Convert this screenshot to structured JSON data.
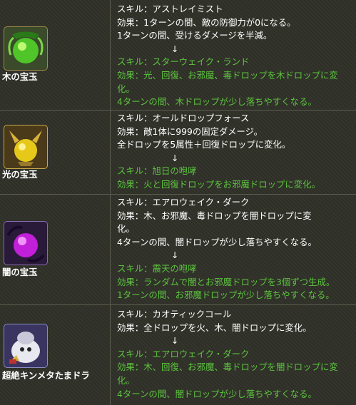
{
  "rows": [
    {
      "name": "木の宝玉",
      "icon": "green-orb-icon",
      "lines": [
        {
          "text": "スキル：アストレイミスト",
          "color": "white"
        },
        {
          "text": "効果：1ターンの間、敵の防御力が0になる。",
          "color": "white"
        },
        {
          "text": "1ターンの間、受けるダメージを半減。",
          "color": "white"
        },
        {
          "text": "↓",
          "color": "white",
          "arrow": true
        },
        {
          "text": "スキル：スターウェイク・ランド",
          "color": "green"
        },
        {
          "text": "効果：光、回復、お邪魔、毒ドロップを木ドロップに変",
          "color": "green"
        },
        {
          "text": "化。",
          "color": "green"
        },
        {
          "text": "4ターンの間、木ドロップが少し落ちやすくなる。",
          "color": "green"
        }
      ]
    },
    {
      "name": "光の宝玉",
      "icon": "yellow-orb-icon",
      "lines": [
        {
          "text": "スキル：オールドロップフォース",
          "color": "white"
        },
        {
          "text": "効果：敵1体に999の固定ダメージ。",
          "color": "white"
        },
        {
          "text": "全ドロップを5属性＋回復ドロップに変化。",
          "color": "white"
        },
        {
          "text": "↓",
          "color": "white",
          "arrow": true
        },
        {
          "text": "スキル：旭日の咆哮",
          "color": "green"
        },
        {
          "text": "効果：火と回復ドロップをお邪魔ドロップに変化。",
          "color": "green"
        }
      ]
    },
    {
      "name": "闇の宝玉",
      "icon": "purple-orb-icon",
      "lines": [
        {
          "text": "スキル：エアロウェイク・ダーク",
          "color": "white"
        },
        {
          "text": "効果：木、お邪魔、毒ドロップを闇ドロップに変",
          "color": "white"
        },
        {
          "text": "化。",
          "color": "white"
        },
        {
          "text": "4ターンの間、闇ドロップが少し落ちやすくなる。",
          "color": "white"
        },
        {
          "text": "↓",
          "color": "white",
          "arrow": true
        },
        {
          "text": "スキル：震天の咆哮",
          "color": "green"
        },
        {
          "text": "効果：ランダムで闇とお邪魔ドロップを3個ずつ生成。",
          "color": "green"
        },
        {
          "text": "1ターンの間、お邪魔ドロップが少し落ちやすくなる。",
          "color": "green"
        }
      ]
    },
    {
      "name": "超絶キンメタたまドラ",
      "icon": "king-metal-dragon-icon",
      "lines": [
        {
          "text": "スキル：カオティックコール",
          "color": "white"
        },
        {
          "text": "効果：全ドロップを火、木、闇ドロップに変化。",
          "color": "white"
        },
        {
          "text": "↓",
          "color": "white",
          "arrow": true
        },
        {
          "text": "スキル：エアロウェイク・ダーク",
          "color": "green"
        },
        {
          "text": "効果：木、回復、お邪魔、毒ドロップを闇ドロップに変",
          "color": "green"
        },
        {
          "text": "化。",
          "color": "green"
        },
        {
          "text": "4ターンの間、闇ドロップが少し落ちやすくなる。",
          "color": "green"
        }
      ]
    }
  ],
  "colors": {
    "white": "#ffffff",
    "green": "#5cc33e",
    "border": "#5c5c4e",
    "background": "#2f3028"
  }
}
